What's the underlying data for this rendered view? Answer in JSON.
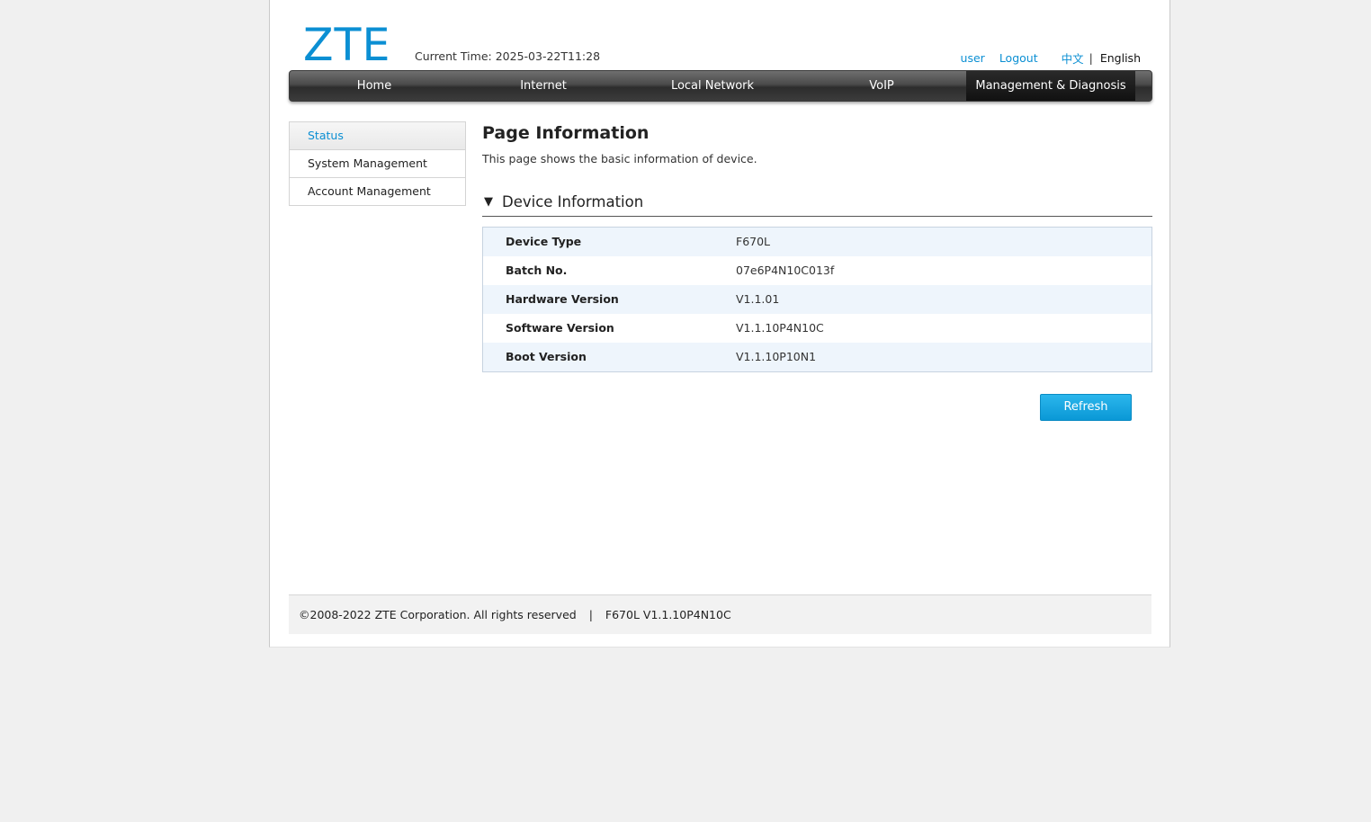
{
  "header": {
    "logo_text": "ZTE",
    "current_time_label": "Current Time:",
    "current_time_value": "2025-03-22T11:28",
    "user_link": "user",
    "logout_link": "Logout",
    "lang_chinese": "中文",
    "lang_separator": "|",
    "lang_english": "English"
  },
  "nav": {
    "items": [
      {
        "label": "Home"
      },
      {
        "label": "Internet"
      },
      {
        "label": "Local Network"
      },
      {
        "label": "VoIP"
      },
      {
        "label": "Management & Diagnosis"
      }
    ],
    "active_index": 4
  },
  "sidebar": {
    "items": [
      {
        "label": "Status"
      },
      {
        "label": "System Management"
      },
      {
        "label": "Account Management"
      }
    ],
    "active_index": 0
  },
  "main": {
    "title": "Page Information",
    "description": "This page shows the basic information of device.",
    "section": {
      "toggle_glyph": "▼",
      "title": "Device Information",
      "rows": [
        {
          "label": "Device Type",
          "value": "F670L"
        },
        {
          "label": "Batch No.",
          "value": "07e6P4N10C013f"
        },
        {
          "label": "Hardware Version",
          "value": "V1.1.01"
        },
        {
          "label": "Software Version",
          "value": "V1.1.10P4N10C"
        },
        {
          "label": "Boot Version",
          "value": "V1.1.10P10N1"
        }
      ]
    },
    "refresh_label": "Refresh"
  },
  "footer": {
    "copyright": "©2008-2022 ZTE Corporation. All rights reserved",
    "separator": "|",
    "version": "F670L V1.1.10P4N10C"
  },
  "colors": {
    "accent": "#0b8fd3",
    "nav_dark": "#2c2c2c",
    "row_alt": "#eef5fc",
    "page_bg": "#f0f0f0"
  }
}
